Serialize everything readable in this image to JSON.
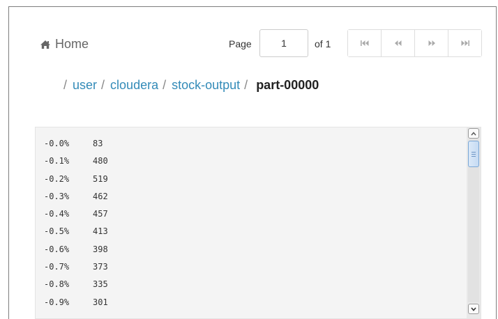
{
  "header": {
    "home_label": "Home",
    "page_label": "Page",
    "page_value": "1",
    "of_label": "of 1"
  },
  "pager": {
    "buttons": [
      "first-page-icon",
      "previous-page-icon",
      "next-page-icon",
      "last-page-icon"
    ]
  },
  "breadcrumb": {
    "items": [
      "user",
      "cloudera",
      "stock-output"
    ],
    "current": "part-00000",
    "separator": "/"
  },
  "content": {
    "lines": [
      {
        "key": "-0.0%",
        "value": "83"
      },
      {
        "key": "-0.1%",
        "value": "480"
      },
      {
        "key": "-0.2%",
        "value": "519"
      },
      {
        "key": "-0.3%",
        "value": "462"
      },
      {
        "key": "-0.4%",
        "value": "457"
      },
      {
        "key": "-0.5%",
        "value": "413"
      },
      {
        "key": "-0.6%",
        "value": "398"
      },
      {
        "key": "-0.7%",
        "value": "373"
      },
      {
        "key": "-0.8%",
        "value": "335"
      },
      {
        "key": "-0.9%",
        "value": "301"
      }
    ]
  },
  "colors": {
    "link": "#338bb8",
    "content_bg": "#f4f4f4"
  }
}
